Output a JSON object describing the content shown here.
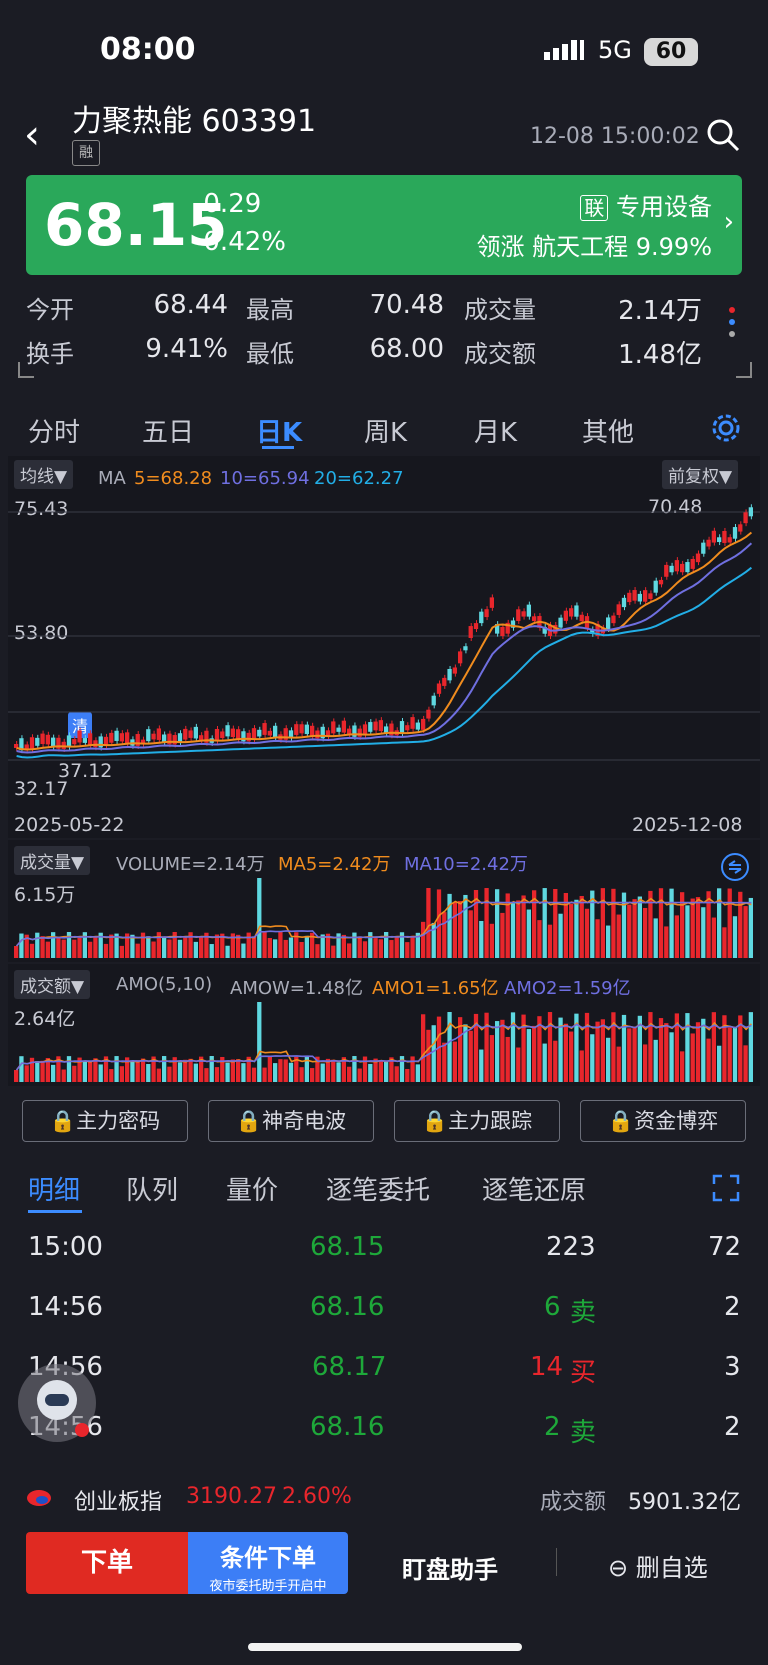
{
  "status": {
    "time": "08:00",
    "network": "5G",
    "battery": "60"
  },
  "header": {
    "title": "力聚热能 603391",
    "tag": "融",
    "datetime": "12-08 15:00:02"
  },
  "quote": {
    "price": "68.15",
    "change": "-0.29",
    "change_pct": "-0.42%",
    "sector_tag": "联",
    "sector": "专用设备",
    "lead_label": "领涨",
    "lead_name": "航天工程",
    "lead_pct": "9.99%",
    "banner_color": "#2aa85a"
  },
  "stats": {
    "open_label": "今开",
    "open": "68.44",
    "high_label": "最高",
    "high": "70.48",
    "volume_label": "成交量",
    "volume": "2.14万",
    "turnover_label": "换手",
    "turnover": "9.41%",
    "low_label": "最低",
    "low": "68.00",
    "amount_label": "成交额",
    "amount": "1.48亿"
  },
  "tabs": [
    "分时",
    "五日",
    "日K",
    "周K",
    "月K",
    "其他"
  ],
  "kline": {
    "indicator": "均线▼",
    "ma_label": "MA",
    "ma5": "5=68.28",
    "ma10": "10=65.94",
    "ma20": "20=62.27",
    "adjust": "前复权▼",
    "y_top": "75.43",
    "y_mid": "53.80",
    "y_bottom": "32.17",
    "max_mark": "70.48",
    "min_mark": "37.12",
    "clear_mark": "清",
    "date_start": "2025-05-22",
    "date_end": "2025-12-08",
    "colors": {
      "ma5": "#f08c1e",
      "ma10": "#6f6fe0",
      "ma20": "#22aee6",
      "up": "#e8262c",
      "down": "#5fd8e0"
    }
  },
  "volume_panel": {
    "indicator": "成交量▼",
    "volume": "VOLUME=2.14万",
    "ma5": "MA5=2.42万",
    "ma10": "MA10=2.42万",
    "y_top": "6.15万"
  },
  "amount_panel": {
    "indicator": "成交额▼",
    "amo": "AMO(5,10)",
    "amow": "AMOW=1.48亿",
    "amo1": "AMO1=1.65亿",
    "amo2": "AMO2=1.59亿",
    "y_top": "2.64亿"
  },
  "tools": [
    "主力密码",
    "神奇电波",
    "主力跟踪",
    "资金博弈"
  ],
  "detail_tabs": [
    "明细",
    "队列",
    "量价",
    "逐笔委托",
    "逐笔还原"
  ],
  "ticks": [
    {
      "time": "15:00",
      "price": "68.15",
      "vol": "223",
      "side": "",
      "count": "72"
    },
    {
      "time": "14:56",
      "price": "68.16",
      "vol": "6",
      "side": "卖",
      "count": "2"
    },
    {
      "time": "14:56",
      "price": "68.17",
      "vol": "14",
      "side": "买",
      "count": "3"
    },
    {
      "time": "14:56",
      "price": "68.16",
      "vol": "2",
      "side": "卖",
      "count": "2"
    }
  ],
  "index_bar": {
    "name": "创业板指",
    "value": "3190.27",
    "pct": "2.60%",
    "amount_label": "成交额",
    "amount": "5901.32亿"
  },
  "actions": {
    "order": "下单",
    "cond": "条件下单",
    "cond_sub": "夜市委托助手开启中",
    "helper": "盯盘助手",
    "remove": "删自选"
  }
}
